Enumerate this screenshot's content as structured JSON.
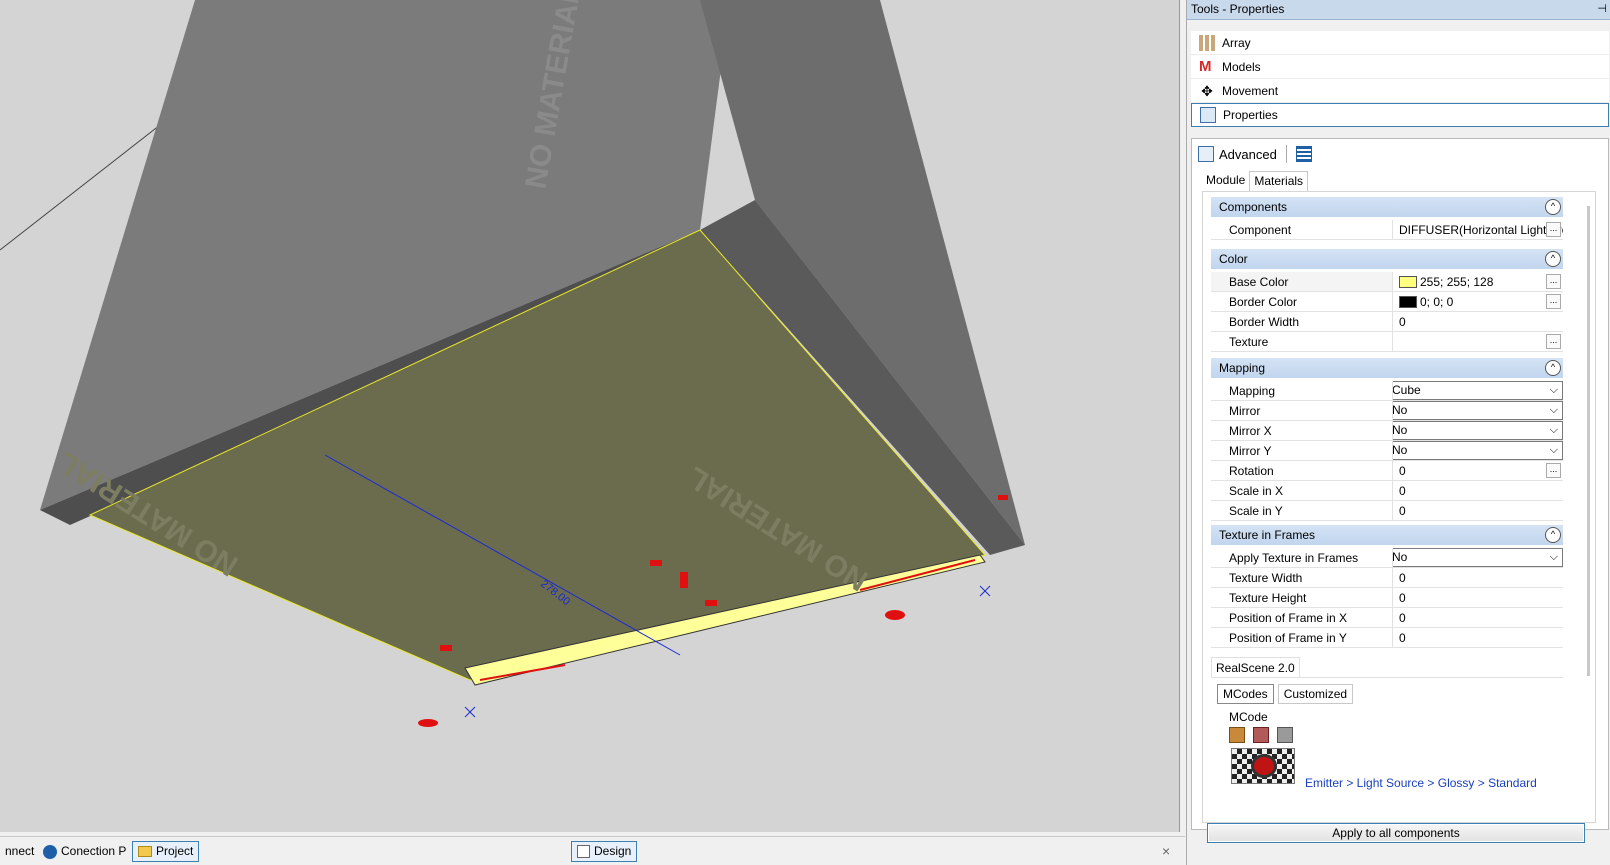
{
  "viewport": {
    "watermark": "NO MATERIAL",
    "dimension_label": "278.00",
    "colors": {
      "box_face": "#6e6e6e",
      "bottom_face": "#6a6a4e",
      "light_strip": "#ffff99",
      "dimension_blue": "#1a2bd6",
      "handle_red": "#e01010"
    }
  },
  "statusbar": {
    "tabs": [
      {
        "label": "nnect"
      },
      {
        "label": "Conection P"
      },
      {
        "label": "Project"
      },
      {
        "label": "Design"
      }
    ],
    "close_glyph": "×"
  },
  "panel": {
    "title": "Tools - Properties",
    "pin_glyph": "⊣",
    "nav": [
      {
        "label": "Array",
        "icon": "array-icon"
      },
      {
        "label": "Models",
        "icon": "models-icon"
      },
      {
        "label": "Movement",
        "icon": "movement-icon"
      },
      {
        "label": "Properties",
        "icon": "properties-icon"
      }
    ],
    "advanced_label": "Advanced",
    "subtabs": [
      "Module",
      "Materials"
    ],
    "categories": {
      "components": {
        "title": "Components",
        "rows": [
          {
            "key": "Component",
            "value": "DIFFUSER(Horizontal Light Profi"
          }
        ]
      },
      "color": {
        "title": "Color",
        "rows": [
          {
            "key": "Base Color",
            "value": "255; 255; 128",
            "swatch": "#ffff80"
          },
          {
            "key": "Border Color",
            "value": "0; 0; 0",
            "swatch": "#000000"
          },
          {
            "key": "Border Width",
            "value": "0"
          },
          {
            "key": "Texture",
            "value": ""
          }
        ]
      },
      "mapping": {
        "title": "Mapping",
        "rows": [
          {
            "key": "Mapping",
            "value": "Cube"
          },
          {
            "key": "Mirror",
            "value": "No"
          },
          {
            "key": "Mirror X",
            "value": "No"
          },
          {
            "key": "Mirror Y",
            "value": "No"
          },
          {
            "key": "Rotation",
            "value": "0"
          },
          {
            "key": "Scale in X",
            "value": "0"
          },
          {
            "key": "Scale in Y",
            "value": "0"
          }
        ]
      },
      "texture_frames": {
        "title": "Texture in Frames",
        "rows": [
          {
            "key": "Apply Texture in Frames",
            "value": "No"
          },
          {
            "key": "Texture Width",
            "value": "0"
          },
          {
            "key": "Texture Height",
            "value": "0"
          },
          {
            "key": "Position of Frame  in X",
            "value": "0"
          },
          {
            "key": "Position of Frame  in Y",
            "value": "0"
          }
        ]
      }
    },
    "realscene": {
      "label": "RealScene 2.0",
      "tabs": [
        "MCodes",
        "Customized"
      ],
      "mcode_label": "MCode",
      "mcode_path": "Emitter > Light Source > Glossy > Standard"
    },
    "apply_button": "Apply to all components",
    "dots": "...",
    "collapse_glyph": "^",
    "chevron": "⌵"
  }
}
